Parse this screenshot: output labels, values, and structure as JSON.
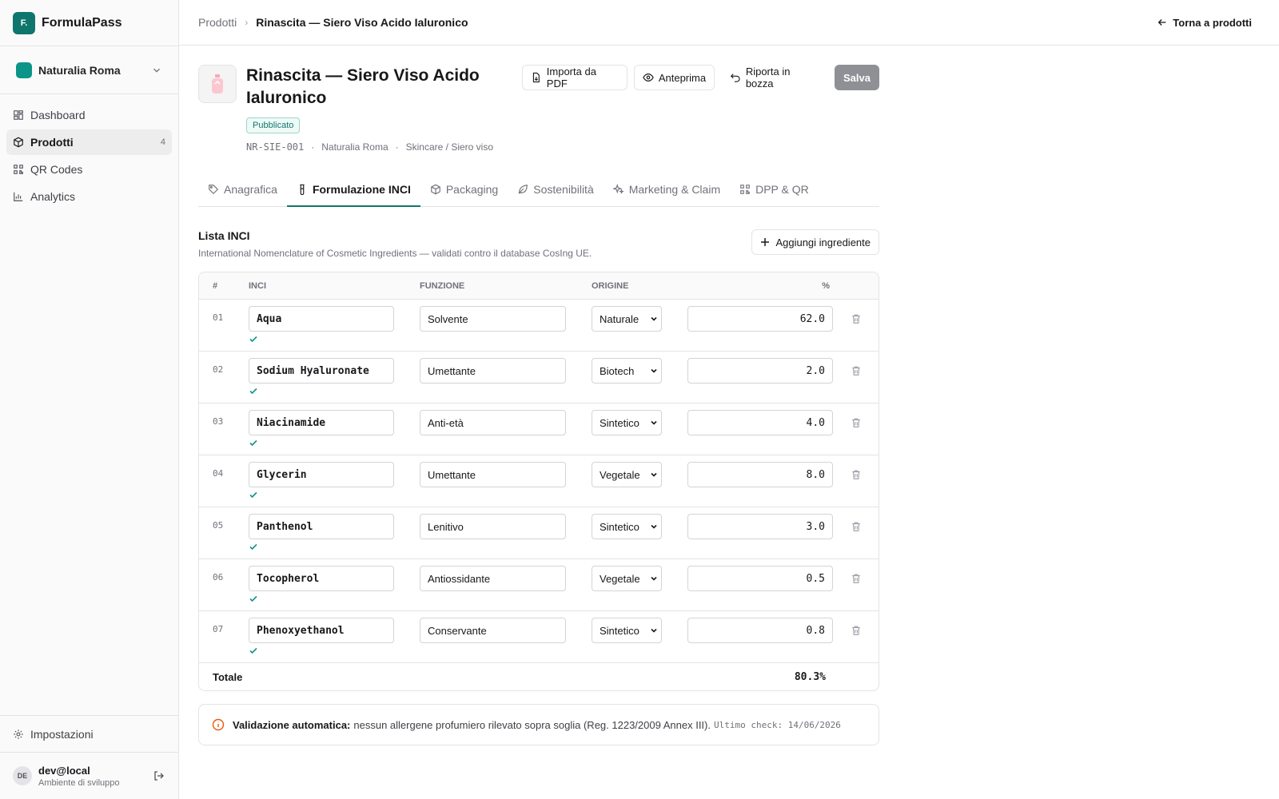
{
  "app": {
    "logo": "F.",
    "name": "FormulaPass"
  },
  "org": {
    "name": "Naturalia Roma",
    "color": "#0d9488"
  },
  "nav": [
    {
      "label": "Dashboard",
      "icon": "dashboard-icon",
      "count": ""
    },
    {
      "label": "Prodotti",
      "icon": "box-icon",
      "count": "4",
      "active": true
    },
    {
      "label": "QR Codes",
      "icon": "qr-icon",
      "count": ""
    },
    {
      "label": "Analytics",
      "icon": "chart-icon",
      "count": ""
    }
  ],
  "settings": {
    "label": "Impostazioni"
  },
  "user": {
    "initials": "DE",
    "name": "dev@local",
    "env": "Ambiente di sviluppo"
  },
  "breadcrumb": {
    "parent": "Prodotti",
    "current": "Rinascita — Siero Viso Acido Ialuronico"
  },
  "back_label": "Torna a prodotti",
  "product": {
    "title": "Rinascita — Siero Viso Acido Ialuronico",
    "status": "Pubblicato",
    "sku": "NR-SIE-001",
    "brand": "Naturalia Roma",
    "category": "Skincare / Siero viso"
  },
  "actions": {
    "import_pdf": "Importa da PDF",
    "preview": "Anteprima",
    "revert": "Riporta in bozza",
    "save": "Salva"
  },
  "tabs": [
    {
      "label": "Anagrafica",
      "icon": "tag-icon"
    },
    {
      "label": "Formulazione INCI",
      "icon": "flask-icon",
      "active": true
    },
    {
      "label": "Packaging",
      "icon": "package-icon"
    },
    {
      "label": "Sostenibilità",
      "icon": "leaf-icon"
    },
    {
      "label": "Marketing & Claim",
      "icon": "sparkles-icon"
    },
    {
      "label": "DPP & QR",
      "icon": "qr-icon"
    }
  ],
  "inci": {
    "title": "Lista INCI",
    "subtitle": "International Nomenclature of Cosmetic Ingredients — validati contro il database CosIng UE.",
    "add_label": "Aggiungi ingrediente",
    "columns": {
      "num": "#",
      "inci": "INCI",
      "function": "FUNZIONE",
      "origin": "ORIGINE",
      "pct": "%"
    },
    "rows": [
      {
        "num": "01",
        "inci": "Aqua",
        "function": "Solvente",
        "origin": "Naturale",
        "pct": "62.0"
      },
      {
        "num": "02",
        "inci": "Sodium Hyaluronate",
        "function": "Umettante",
        "origin": "Biotech",
        "pct": "2.0"
      },
      {
        "num": "03",
        "inci": "Niacinamide",
        "function": "Anti-età",
        "origin": "Sintetico",
        "pct": "4.0"
      },
      {
        "num": "04",
        "inci": "Glycerin",
        "function": "Umettante",
        "origin": "Vegetale",
        "pct": "8.0"
      },
      {
        "num": "05",
        "inci": "Panthenol",
        "function": "Lenitivo",
        "origin": "Sintetico",
        "pct": "3.0"
      },
      {
        "num": "06",
        "inci": "Tocopherol",
        "function": "Antiossidante",
        "origin": "Vegetale",
        "pct": "0.5"
      },
      {
        "num": "07",
        "inci": "Phenoxyethanol",
        "function": "Conservante",
        "origin": "Sintetico",
        "pct": "0.8"
      }
    ],
    "total_label": "Totale",
    "total_value": "80.3%"
  },
  "validation": {
    "label": "Validazione automatica:",
    "message": "nessun allergene profumiero rilevato sopra soglia (Reg. 1223/2009 Annex III).",
    "last_check": "Ultimo check: 14/06/2026"
  },
  "colors": {
    "accent": "#0f766e",
    "check": "#0d9488",
    "info": "#ea580c",
    "save_disabled": "#8f8f96"
  }
}
